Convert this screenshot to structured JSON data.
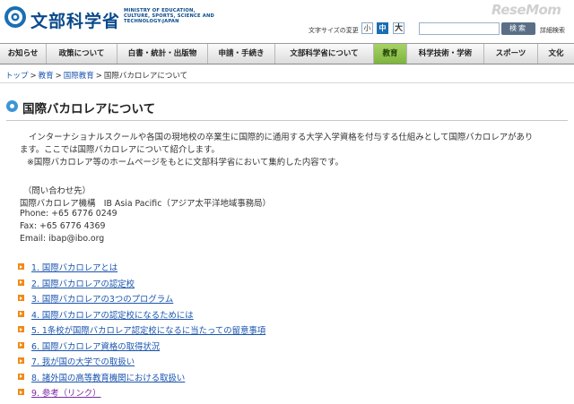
{
  "header": {
    "logo_jp": "文部科学省",
    "logo_en": "MINISTRY OF EDUCATION, CULTURE, SPORTS, SCIENCE AND TECHNOLOGY-JAPAN",
    "font_size_label": "文字サイズの変更",
    "font_sizes": [
      "小",
      "中",
      "大"
    ],
    "search_placeholder": "",
    "search_button": "検索",
    "advanced_search": "詳細検索",
    "watermark": "ReseMom"
  },
  "gnav": {
    "items": [
      {
        "label": "お知らせ"
      },
      {
        "label": "政策について"
      },
      {
        "label": "白書・統計・出版物"
      },
      {
        "label": "申請・手続き"
      },
      {
        "label": "文部科学省について"
      },
      {
        "label": "教育"
      },
      {
        "label": "科学技術・学術"
      },
      {
        "label": "スポーツ"
      },
      {
        "label": "文化"
      }
    ]
  },
  "breadcrumb": {
    "items": [
      "トップ",
      "教育",
      "国際教育",
      "国際バカロレアについて"
    ],
    "separator": ">"
  },
  "page": {
    "title": "国際バカロレアについて",
    "intro_line1": "インターナショナルスクールや各国の現地校の卒業生に国際的に通用する大学入学資格を付与する仕組みとして国際バカロレアがあり",
    "intro_line2": "ます。ここでは国際バカロレアについて紹介します。",
    "note": "※国際バカロレア等のホームページをもとに文部科学省において集約した内容です。",
    "contact_heading": "（問い合わせ先）",
    "contact_org": "国際バカロレア機構　IB Asia Pacific（アジア太平洋地域事務局）",
    "contact_phone": "Phone: +65 6776 0249",
    "contact_fax": "Fax: +65 6776 4369",
    "contact_email": "Email: ibap@ibo.org"
  },
  "links": [
    {
      "label": "1. 国際バカロレアとは"
    },
    {
      "label": "2. 国際バカロレアの認定校"
    },
    {
      "label": "3. 国際バカロレアの3つのプログラム"
    },
    {
      "label": "4. 国際バカロレアの認定校になるためには"
    },
    {
      "label": "5. 1条校が国際バカロレア認定校になるに当たっての留意事項"
    },
    {
      "label": "6. 国際バカロレア資格の取得状況"
    },
    {
      "label": "7. 我が国の大学での取扱い"
    },
    {
      "label": "8. 諸外国の高等教育機関における取扱い"
    },
    {
      "label": "9. 参考（リンク）"
    }
  ],
  "colors": {
    "brand_blue": "#0a4a8c",
    "link_blue": "#1a55b0",
    "active_nav_green": "#7db53c",
    "bullet_orange": "#f08a14",
    "visited_purple": "#7a2aa6"
  }
}
